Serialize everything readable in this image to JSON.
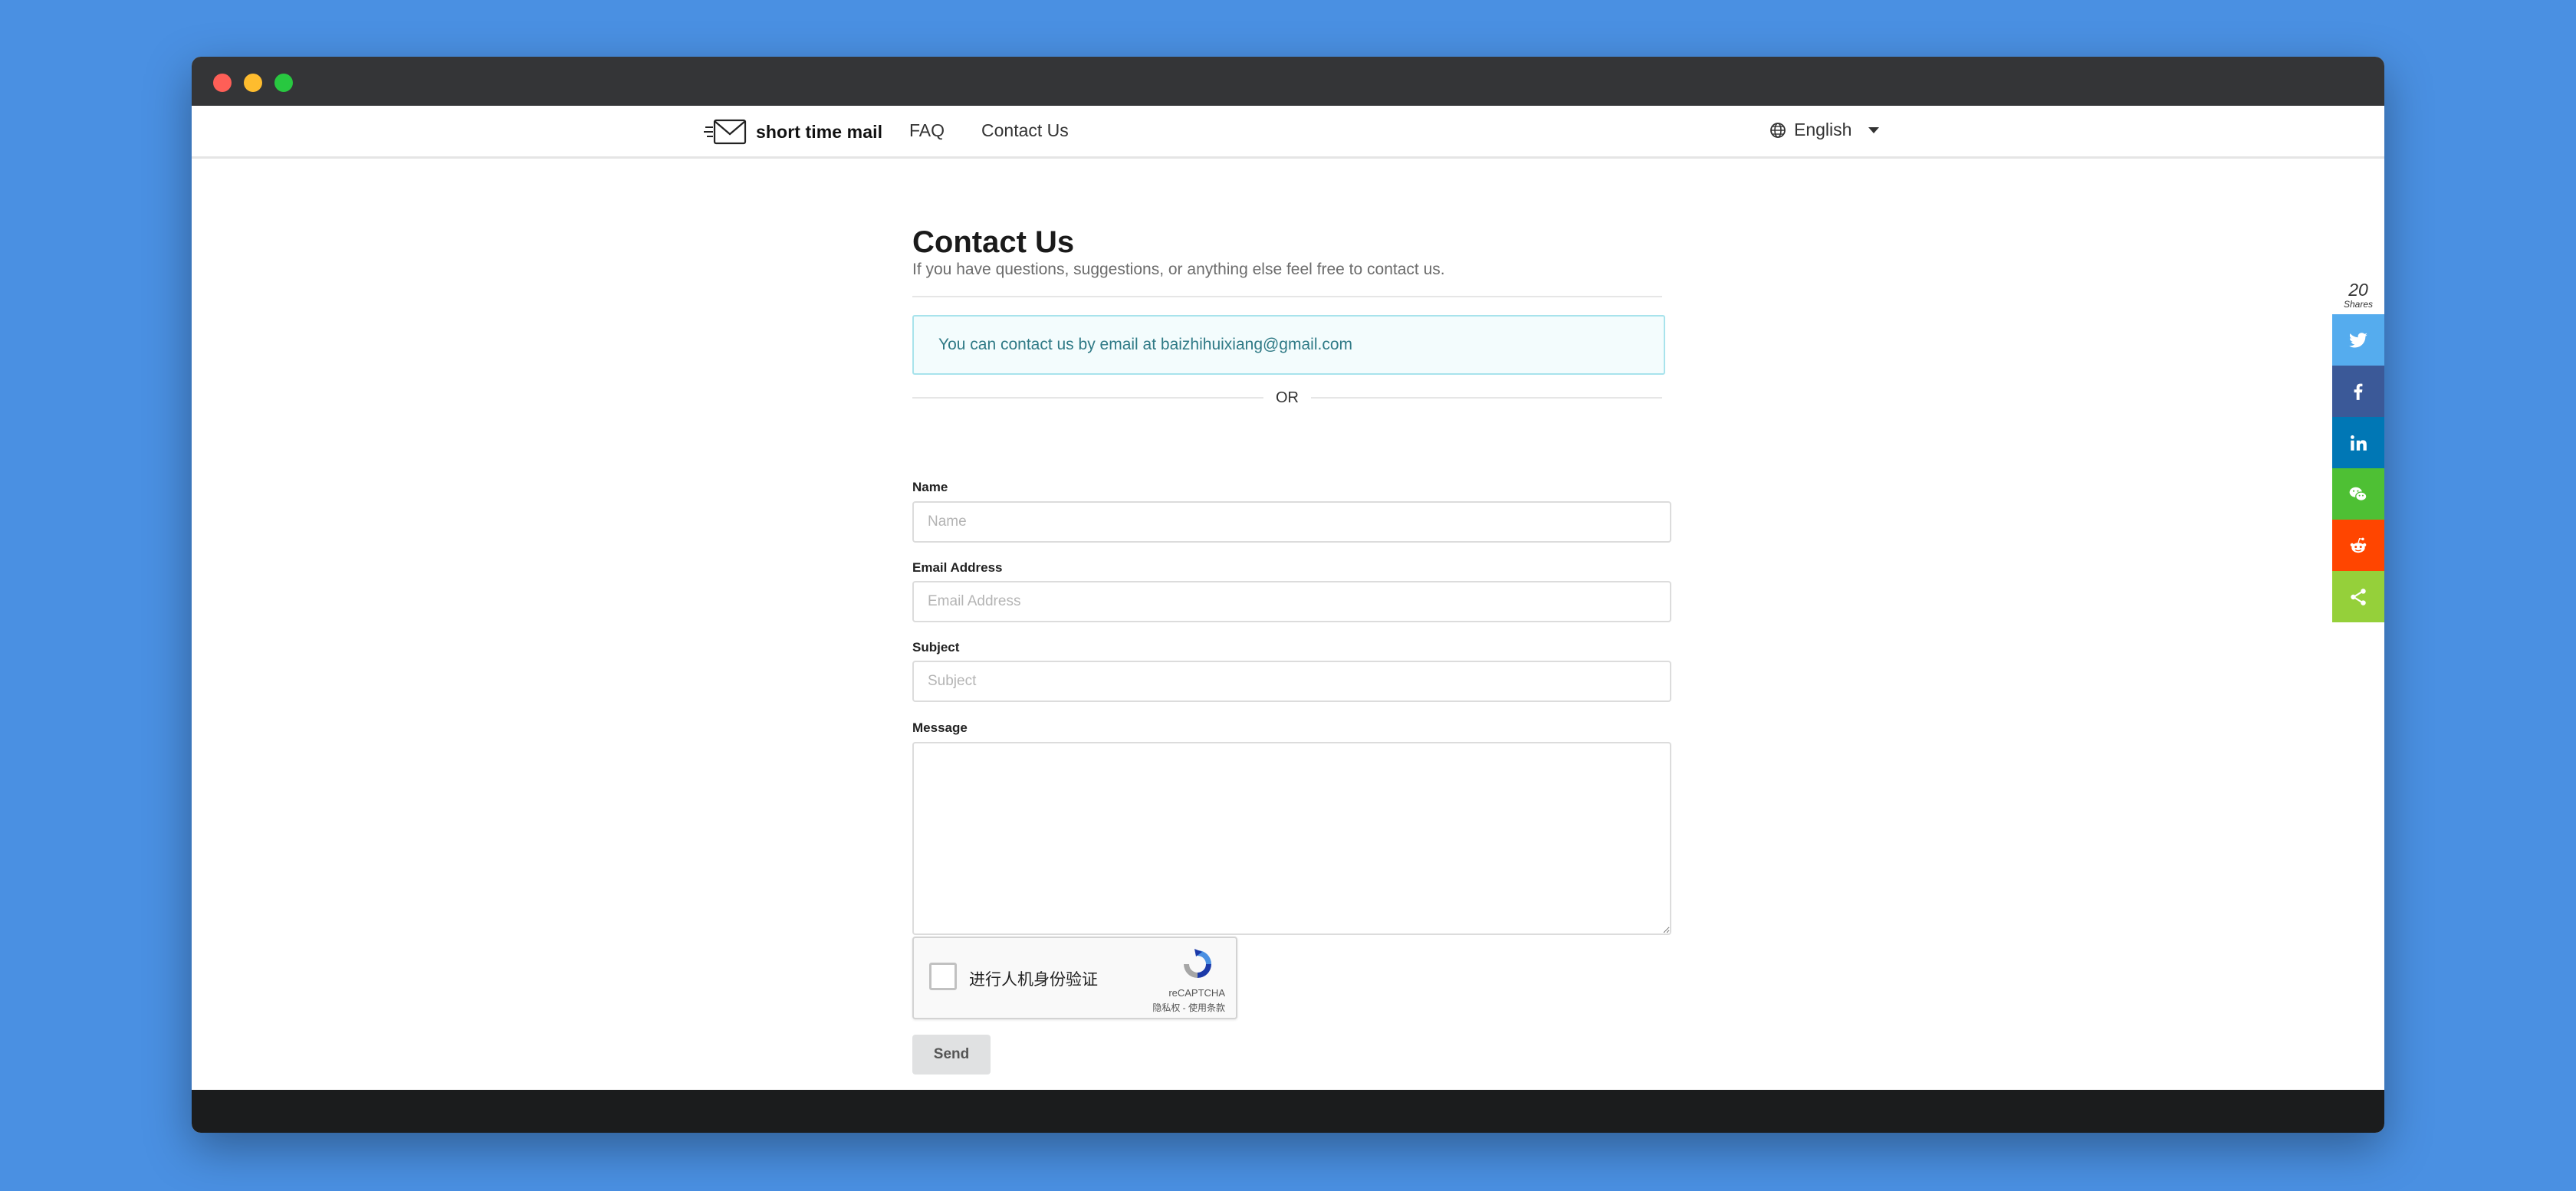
{
  "nav": {
    "brand": "short time mail",
    "links": [
      "FAQ",
      "Contact Us"
    ],
    "language": "English"
  },
  "page": {
    "title": "Contact Us",
    "subtitle": "If you have questions, suggestions, or anything else feel free to contact us.",
    "alert": "You can contact us by email at baizhihuixiang@gmail.com",
    "or": "OR"
  },
  "form": {
    "name": {
      "label": "Name",
      "placeholder": "Name"
    },
    "email": {
      "label": "Email Address",
      "placeholder": "Email Address"
    },
    "subject": {
      "label": "Subject",
      "placeholder": "Subject"
    },
    "message": {
      "label": "Message"
    },
    "send": "Send"
  },
  "captcha": {
    "checkbox_label": "进行人机身份验证",
    "brand": "reCAPTCHA",
    "terms": "隐私权 - 使用条款"
  },
  "share": {
    "count": "20",
    "label": "Shares",
    "icons": [
      "twitter-icon",
      "facebook-icon",
      "linkedin-icon",
      "wechat-icon",
      "reddit-icon",
      "share-icon"
    ]
  },
  "colors": {
    "background": "#4a90e2",
    "titlebar": "#343537",
    "alert_border": "#a8e3ec",
    "alert_text": "#2f7a86",
    "twitter": "#55acee",
    "facebook": "#3b5998",
    "linkedin": "#0077b5",
    "wechat": "#4ec034",
    "reddit": "#ff4500",
    "share": "#95d03a",
    "footer": "#1b1c1d"
  }
}
